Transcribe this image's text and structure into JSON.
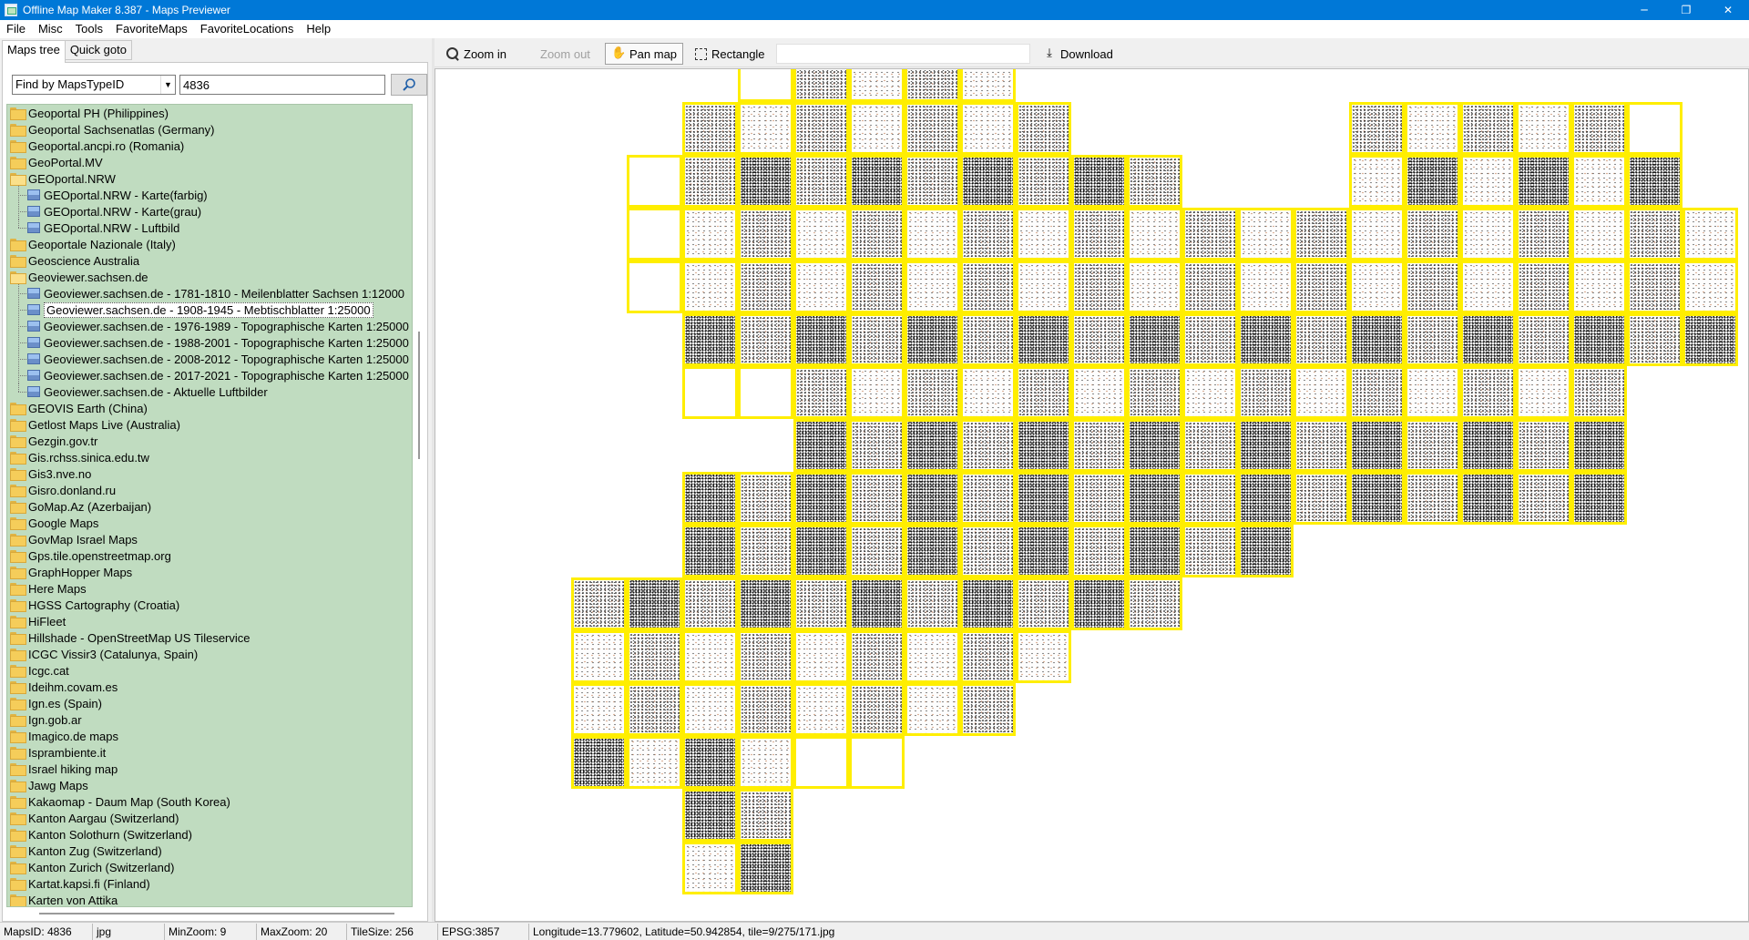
{
  "window": {
    "title": "Offline Map Maker 8.387 - Maps Previewer",
    "controls": [
      "─",
      "❐",
      "✕"
    ]
  },
  "menu": [
    "File",
    "Misc",
    "Tools",
    "FavoriteMaps",
    "FavoriteLocations",
    "Help"
  ],
  "left_panel": {
    "tabs": [
      "Maps tree",
      "Quick goto"
    ],
    "finder": {
      "select_value": "Find by MapsTypeID",
      "search_value": "4836",
      "search_button_icon": "magnifier-icon"
    },
    "tree": [
      {
        "label": "Geoportal PH (Philippines)",
        "type": "folder"
      },
      {
        "label": "Geoportal Sachsenatlas (Germany)",
        "type": "folder"
      },
      {
        "label": "Geoportal.ancpi.ro (Romania)",
        "type": "folder"
      },
      {
        "label": "GeoPortal.MV",
        "type": "folder"
      },
      {
        "label": "GEOportal.NRW",
        "type": "folder-open"
      },
      {
        "label": "GEOportal.NRW - Karte(farbig)",
        "type": "map"
      },
      {
        "label": "GEOportal.NRW - Karte(grau)",
        "type": "map"
      },
      {
        "label": "GEOportal.NRW - Luftbild",
        "type": "map-last"
      },
      {
        "label": "Geoportale Nazionale (Italy)",
        "type": "folder"
      },
      {
        "label": "Geoscience Australia",
        "type": "folder"
      },
      {
        "label": "Geoviewer.sachsen.de",
        "type": "folder-open"
      },
      {
        "label": "Geoviewer.sachsen.de - 1781-1810 - Meilenblatter Sachsen 1:12000",
        "type": "map"
      },
      {
        "label": "Geoviewer.sachsen.de - 1908-1945 - Mebtischblatter 1:25000",
        "type": "map-selected"
      },
      {
        "label": "Geoviewer.sachsen.de - 1976-1989 - Topographische Karten 1:25000",
        "type": "map"
      },
      {
        "label": "Geoviewer.sachsen.de - 1988-2001 - Topographische Karten 1:25000",
        "type": "map"
      },
      {
        "label": "Geoviewer.sachsen.de - 2008-2012 - Topographische Karten 1:25000",
        "type": "map"
      },
      {
        "label": "Geoviewer.sachsen.de - 2017-2021 - Topographische Karten 1:25000",
        "type": "map"
      },
      {
        "label": "Geoviewer.sachsen.de - Aktuelle Luftbilder",
        "type": "map-last"
      },
      {
        "label": "GEOVIS Earth (China)",
        "type": "folder"
      },
      {
        "label": "Getlost Maps Live (Australia)",
        "type": "folder"
      },
      {
        "label": "Gezgin.gov.tr",
        "type": "folder"
      },
      {
        "label": "Gis.rchss.sinica.edu.tw",
        "type": "folder"
      },
      {
        "label": "Gis3.nve.no",
        "type": "folder"
      },
      {
        "label": "Gisro.donland.ru",
        "type": "folder"
      },
      {
        "label": "GoMap.Az (Azerbaijan)",
        "type": "folder"
      },
      {
        "label": "Google Maps",
        "type": "folder"
      },
      {
        "label": "GovMap Israel Maps",
        "type": "folder"
      },
      {
        "label": "Gps.tile.openstreetmap.org",
        "type": "folder"
      },
      {
        "label": "GraphHopper Maps",
        "type": "folder"
      },
      {
        "label": "Here Maps",
        "type": "folder"
      },
      {
        "label": "HGSS Cartography (Croatia)",
        "type": "folder"
      },
      {
        "label": "HiFleet",
        "type": "folder"
      },
      {
        "label": "Hillshade - OpenStreetMap US Tileservice",
        "type": "folder"
      },
      {
        "label": "ICGC Vissir3 (Catalunya, Spain)",
        "type": "folder"
      },
      {
        "label": "Icgc.cat",
        "type": "folder"
      },
      {
        "label": "Ideihm.covam.es",
        "type": "folder"
      },
      {
        "label": "Ign.es (Spain)",
        "type": "folder"
      },
      {
        "label": "Ign.gob.ar",
        "type": "folder"
      },
      {
        "label": "Imagico.de maps",
        "type": "folder"
      },
      {
        "label": "Isprambiente.it",
        "type": "folder"
      },
      {
        "label": "Israel hiking map",
        "type": "folder"
      },
      {
        "label": "Jawg Maps",
        "type": "folder"
      },
      {
        "label": "Kakaomap - Daum Map (South Korea)",
        "type": "folder"
      },
      {
        "label": "Kanton Aargau (Switzerland)",
        "type": "folder"
      },
      {
        "label": "Kanton Solothurn (Switzerland)",
        "type": "folder"
      },
      {
        "label": "Kanton Zug (Switzerland)",
        "type": "folder"
      },
      {
        "label": "Kanton Zurich (Switzerland)",
        "type": "folder"
      },
      {
        "label": "Kartat.kapsi.fi (Finland)",
        "type": "folder"
      },
      {
        "label": "Karten von Attika",
        "type": "folder"
      }
    ]
  },
  "toolbar": {
    "zoom_in": "Zoom in",
    "zoom_out": "Zoom out",
    "pan_map": "Pan map",
    "rectangle": "Rectangle",
    "download": "Download",
    "hand_glyph": "✋",
    "download_glyph": "⤓"
  },
  "map": {
    "highlight_color": "#ffee00"
  },
  "status": {
    "maps_id": "MapsID: 4836",
    "format": "jpg",
    "min_zoom": "MinZoom: 9",
    "max_zoom": "MaxZoom: 20",
    "tile_size": "TileSize: 256",
    "epsg": "EPSG:3857",
    "coords": "Longitude=13.779602, Latitude=50.942854, tile=9/275/171.jpg"
  }
}
